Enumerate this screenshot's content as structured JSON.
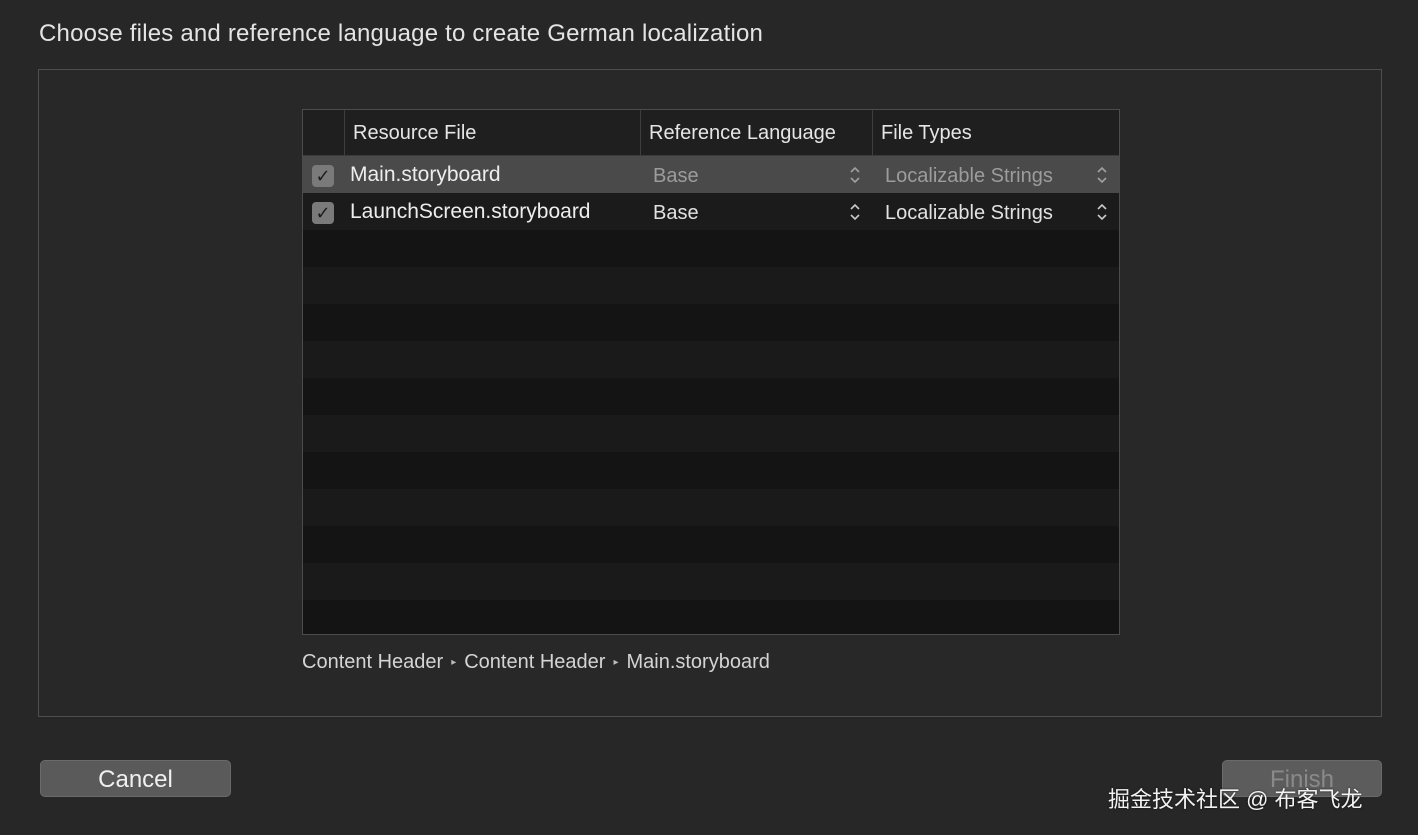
{
  "dialog": {
    "title": "Choose files and reference language to create German localization"
  },
  "table": {
    "columns": [
      "Resource File",
      "Reference Language",
      "File Types"
    ],
    "rows": [
      {
        "checked": true,
        "file": "Main.storyboard",
        "reference_language": "Base",
        "file_type": "Localizable Strings",
        "selected": true
      },
      {
        "checked": true,
        "file": "LaunchScreen.storyboard",
        "reference_language": "Base",
        "file_type": "Localizable Strings",
        "selected": false
      }
    ]
  },
  "breadcrumb": {
    "items": [
      "Content Header",
      "Content Header",
      "Main.storyboard"
    ],
    "separator": "▸"
  },
  "buttons": {
    "cancel": "Cancel",
    "finish": "Finish"
  },
  "watermark": "掘金技术社区 @ 布客飞龙",
  "icons": {
    "checkbox": "checkmark-icon",
    "popup": "chevron-up-down-icon"
  },
  "colors": {
    "background": "#272727",
    "table_background": "#141414",
    "selected_row": "#4a4a4a",
    "button": "#5a5a5a"
  }
}
